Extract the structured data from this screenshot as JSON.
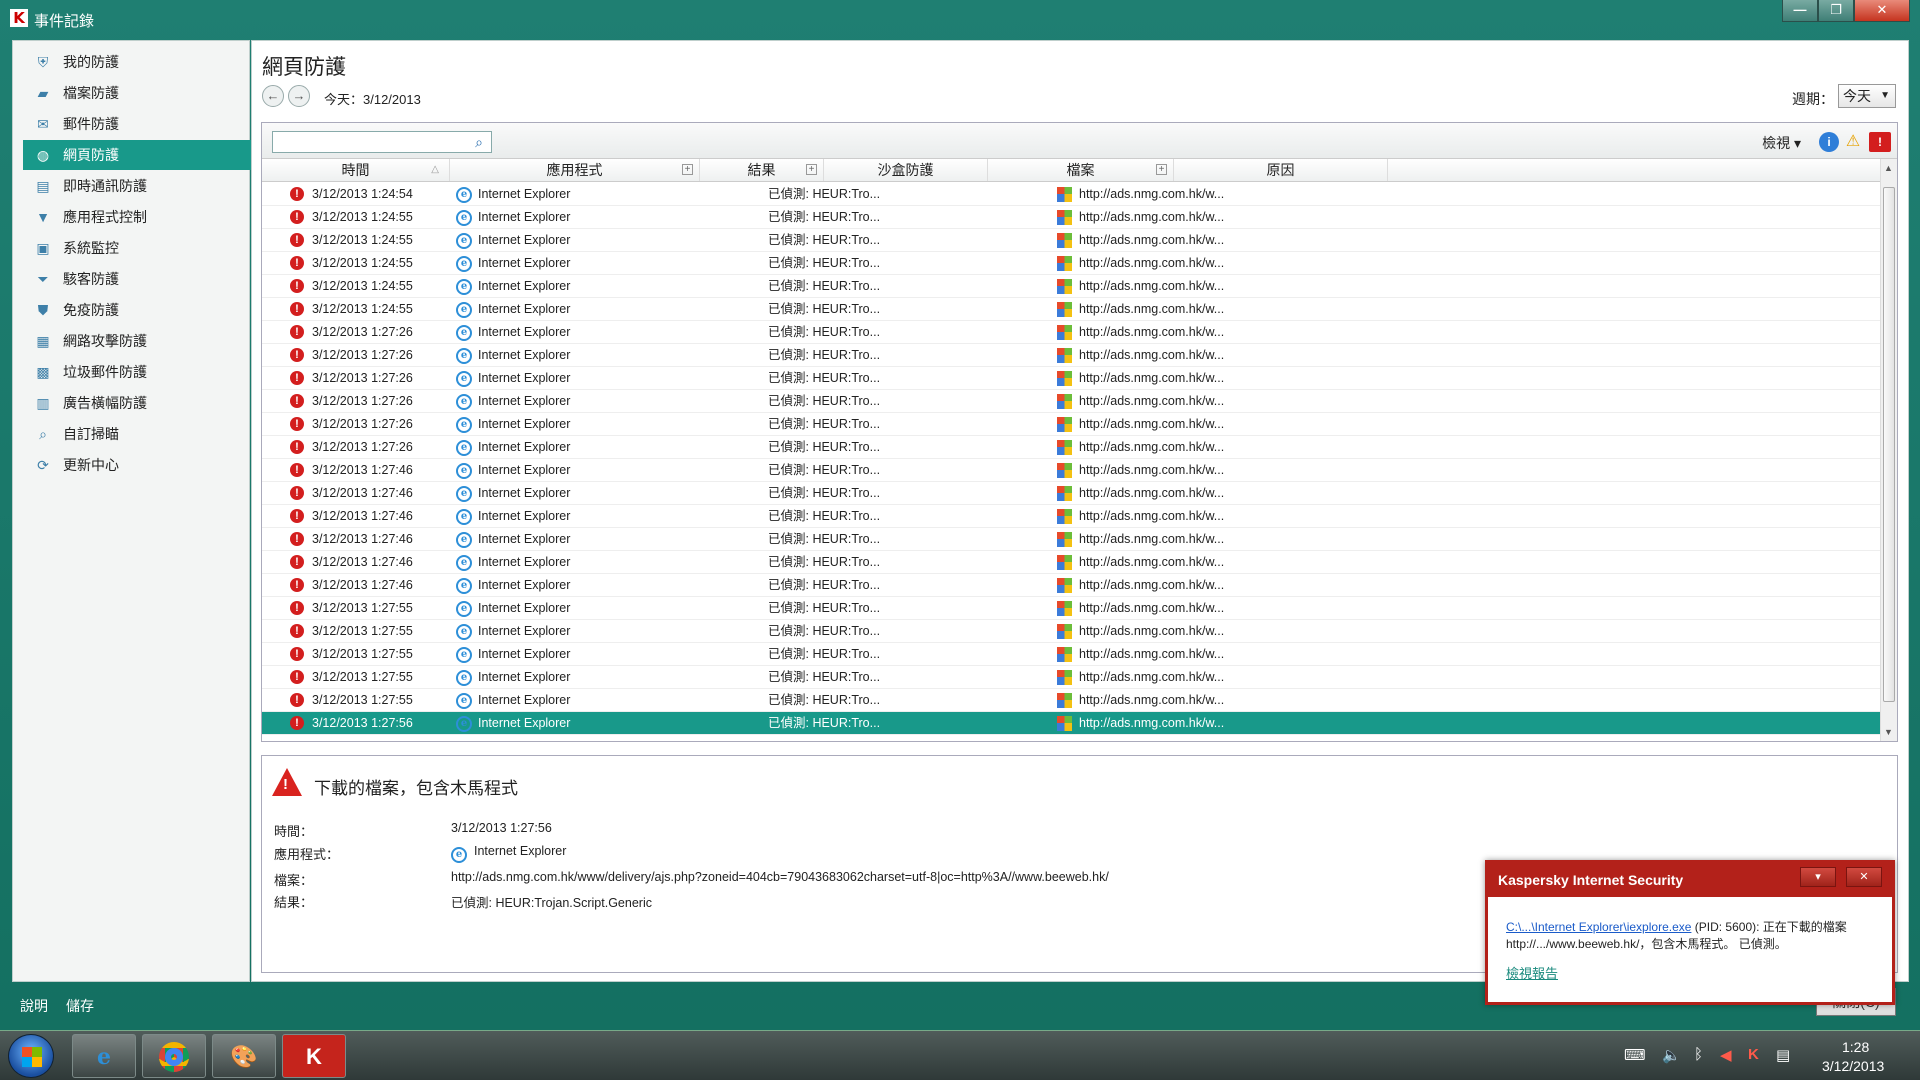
{
  "window": {
    "title": "事件記錄",
    "minimize_label": "—",
    "restore_label": "❐",
    "close_label": "✕"
  },
  "sidebar": {
    "items": [
      {
        "label": "我的防護",
        "icon": "shield-icon",
        "glyph": "⛨"
      },
      {
        "label": "檔案防護",
        "icon": "folder-icon",
        "glyph": "▰"
      },
      {
        "label": "郵件防護",
        "icon": "mail-icon",
        "glyph": "✉"
      },
      {
        "label": "網頁防護",
        "icon": "globe-icon",
        "glyph": "◍"
      },
      {
        "label": "即時通訊防護",
        "icon": "chat-icon",
        "glyph": "▤"
      },
      {
        "label": "應用程式控制",
        "icon": "filter-icon",
        "glyph": "▼"
      },
      {
        "label": "系統監控",
        "icon": "monitor-icon",
        "glyph": "▣"
      },
      {
        "label": "駭客防護",
        "icon": "funnel-icon",
        "glyph": "⏷"
      },
      {
        "label": "免疫防護",
        "icon": "immunity-shield-icon",
        "glyph": "⛊"
      },
      {
        "label": "網路攻擊防護",
        "icon": "network-attack-icon",
        "glyph": "▦"
      },
      {
        "label": "垃圾郵件防護",
        "icon": "spam-icon",
        "glyph": "▩"
      },
      {
        "label": "廣告橫幅防護",
        "icon": "banner-icon",
        "glyph": "▥"
      },
      {
        "label": "自訂掃瞄",
        "icon": "scan-icon",
        "glyph": "⌕"
      },
      {
        "label": "更新中心",
        "icon": "update-icon",
        "glyph": "⟳"
      }
    ],
    "active_index": 3
  },
  "main": {
    "title": "網頁防護",
    "date_label": "今天：3/12/2013",
    "period_label": "週期：",
    "period_value": "今天",
    "view_label": "檢視 ▾"
  },
  "table": {
    "headers": {
      "time": "時間",
      "app": "應用程式",
      "result": "結果",
      "sandbox": "沙盒防護",
      "file": "檔案",
      "reason": "原因"
    },
    "rows": [
      {
        "time": "3/12/2013 1:24:54",
        "app": "Internet Explorer",
        "result": "已偵測: HEUR:Tro...",
        "file": "http://ads.nmg.com.hk/w..."
      },
      {
        "time": "3/12/2013 1:24:55",
        "app": "Internet Explorer",
        "result": "已偵測: HEUR:Tro...",
        "file": "http://ads.nmg.com.hk/w..."
      },
      {
        "time": "3/12/2013 1:24:55",
        "app": "Internet Explorer",
        "result": "已偵測: HEUR:Tro...",
        "file": "http://ads.nmg.com.hk/w..."
      },
      {
        "time": "3/12/2013 1:24:55",
        "app": "Internet Explorer",
        "result": "已偵測: HEUR:Tro...",
        "file": "http://ads.nmg.com.hk/w..."
      },
      {
        "time": "3/12/2013 1:24:55",
        "app": "Internet Explorer",
        "result": "已偵測: HEUR:Tro...",
        "file": "http://ads.nmg.com.hk/w..."
      },
      {
        "time": "3/12/2013 1:24:55",
        "app": "Internet Explorer",
        "result": "已偵測: HEUR:Tro...",
        "file": "http://ads.nmg.com.hk/w..."
      },
      {
        "time": "3/12/2013 1:27:26",
        "app": "Internet Explorer",
        "result": "已偵測: HEUR:Tro...",
        "file": "http://ads.nmg.com.hk/w..."
      },
      {
        "time": "3/12/2013 1:27:26",
        "app": "Internet Explorer",
        "result": "已偵測: HEUR:Tro...",
        "file": "http://ads.nmg.com.hk/w..."
      },
      {
        "time": "3/12/2013 1:27:26",
        "app": "Internet Explorer",
        "result": "已偵測: HEUR:Tro...",
        "file": "http://ads.nmg.com.hk/w..."
      },
      {
        "time": "3/12/2013 1:27:26",
        "app": "Internet Explorer",
        "result": "已偵測: HEUR:Tro...",
        "file": "http://ads.nmg.com.hk/w..."
      },
      {
        "time": "3/12/2013 1:27:26",
        "app": "Internet Explorer",
        "result": "已偵測: HEUR:Tro...",
        "file": "http://ads.nmg.com.hk/w..."
      },
      {
        "time": "3/12/2013 1:27:26",
        "app": "Internet Explorer",
        "result": "已偵測: HEUR:Tro...",
        "file": "http://ads.nmg.com.hk/w..."
      },
      {
        "time": "3/12/2013 1:27:46",
        "app": "Internet Explorer",
        "result": "已偵測: HEUR:Tro...",
        "file": "http://ads.nmg.com.hk/w..."
      },
      {
        "time": "3/12/2013 1:27:46",
        "app": "Internet Explorer",
        "result": "已偵測: HEUR:Tro...",
        "file": "http://ads.nmg.com.hk/w..."
      },
      {
        "time": "3/12/2013 1:27:46",
        "app": "Internet Explorer",
        "result": "已偵測: HEUR:Tro...",
        "file": "http://ads.nmg.com.hk/w..."
      },
      {
        "time": "3/12/2013 1:27:46",
        "app": "Internet Explorer",
        "result": "已偵測: HEUR:Tro...",
        "file": "http://ads.nmg.com.hk/w..."
      },
      {
        "time": "3/12/2013 1:27:46",
        "app": "Internet Explorer",
        "result": "已偵測: HEUR:Tro...",
        "file": "http://ads.nmg.com.hk/w..."
      },
      {
        "time": "3/12/2013 1:27:46",
        "app": "Internet Explorer",
        "result": "已偵測: HEUR:Tro...",
        "file": "http://ads.nmg.com.hk/w..."
      },
      {
        "time": "3/12/2013 1:27:55",
        "app": "Internet Explorer",
        "result": "已偵測: HEUR:Tro...",
        "file": "http://ads.nmg.com.hk/w..."
      },
      {
        "time": "3/12/2013 1:27:55",
        "app": "Internet Explorer",
        "result": "已偵測: HEUR:Tro...",
        "file": "http://ads.nmg.com.hk/w..."
      },
      {
        "time": "3/12/2013 1:27:55",
        "app": "Internet Explorer",
        "result": "已偵測: HEUR:Tro...",
        "file": "http://ads.nmg.com.hk/w..."
      },
      {
        "time": "3/12/2013 1:27:55",
        "app": "Internet Explorer",
        "result": "已偵測: HEUR:Tro...",
        "file": "http://ads.nmg.com.hk/w..."
      },
      {
        "time": "3/12/2013 1:27:55",
        "app": "Internet Explorer",
        "result": "已偵測: HEUR:Tro...",
        "file": "http://ads.nmg.com.hk/w..."
      },
      {
        "time": "3/12/2013 1:27:56",
        "app": "Internet Explorer",
        "result": "已偵測: HEUR:Tro...",
        "file": "http://ads.nmg.com.hk/w..."
      }
    ],
    "selected_index": 23
  },
  "details": {
    "title": "下載的檔案，包含木馬程式",
    "time_label": "時間：",
    "time_value": "3/12/2013 1:27:56",
    "app_label": "應用程式：",
    "app_value": "Internet Explorer",
    "file_label": "檔案：",
    "file_value": "http://ads.nmg.com.hk/www/delivery/ajs.php?zoneid=404cb=79043683062charset=utf-8|oc=http%3A//www.beeweb.hk/",
    "result_label": "結果：",
    "result_value": "已偵測: HEUR:Trojan.Script.Generic"
  },
  "footer": {
    "help_label": "說明",
    "save_label": "儲存",
    "close_label": "關閉(C)"
  },
  "notification": {
    "title": "Kaspersky Internet Security",
    "path_link": "C:\\...\\Internet Explorer\\iexplore.exe",
    "message": " (PID: 5600): 正在下載的檔案http://.../www.beeweb.hk/，包含木馬程式。 已偵測。",
    "report_link": "檢視報告",
    "dropdown_label": "▾",
    "close_label": "✕"
  },
  "taskbar": {
    "clock_time": "1:28",
    "clock_date": "3/12/2013"
  },
  "colors": {
    "accent_teal": "#18998a",
    "alert_red": "#d31e1e",
    "popup_red": "#b3211a"
  }
}
